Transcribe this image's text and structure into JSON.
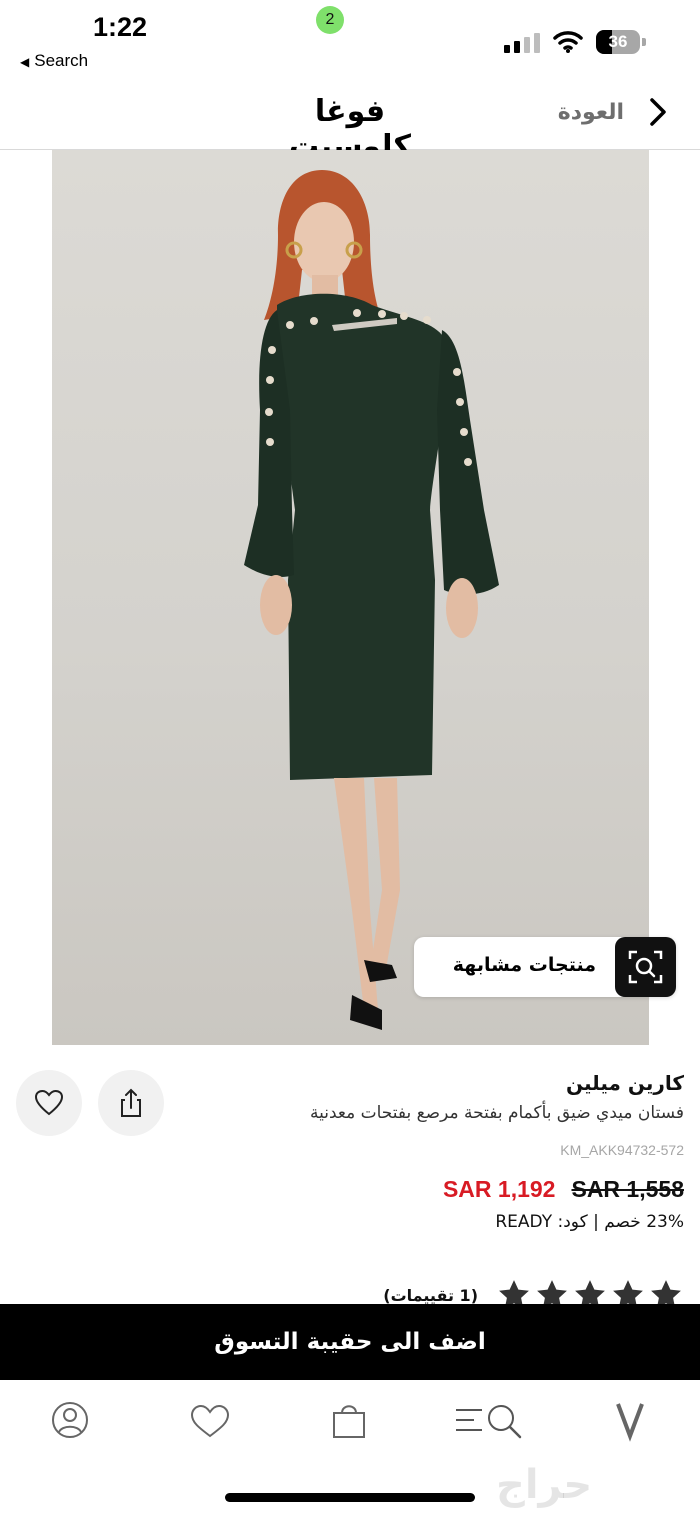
{
  "status_bar": {
    "time": "1:22",
    "back_app_label": "Search",
    "battery_level": "36"
  },
  "header": {
    "title": "فوغا كلوسيت",
    "back_label": "العودة"
  },
  "image_overlay": {
    "similar_products_label": "منتجات مشابهة"
  },
  "product": {
    "brand": "كارين ميلين",
    "description": "فستان ميدي ضيق بأكمام بفتحة مرصع بفتحات معدنية",
    "sku": "KM_AKK94732-572",
    "price_sale": "SAR 1,192",
    "price_original": "SAR 1,558",
    "discount_text": "23% خصم | كود: READY",
    "rating": 5,
    "rating_max": 5,
    "reviews_count": "(1 تقييمات)"
  },
  "actions": {
    "add_to_bag_label": "اضف الى حقيبة التسوق"
  },
  "tab_bar": {
    "cart_count": "2",
    "logo_glyph": "V",
    "icons": [
      "profile-icon",
      "heart-icon",
      "shopping-bag-icon",
      "menu-search-icon",
      "brand-logo-icon"
    ]
  },
  "watermark": "حراج",
  "colors": {
    "sale_price": "#d81b24",
    "cart_badge": "#7fe06b",
    "primary_button": "#000000"
  }
}
